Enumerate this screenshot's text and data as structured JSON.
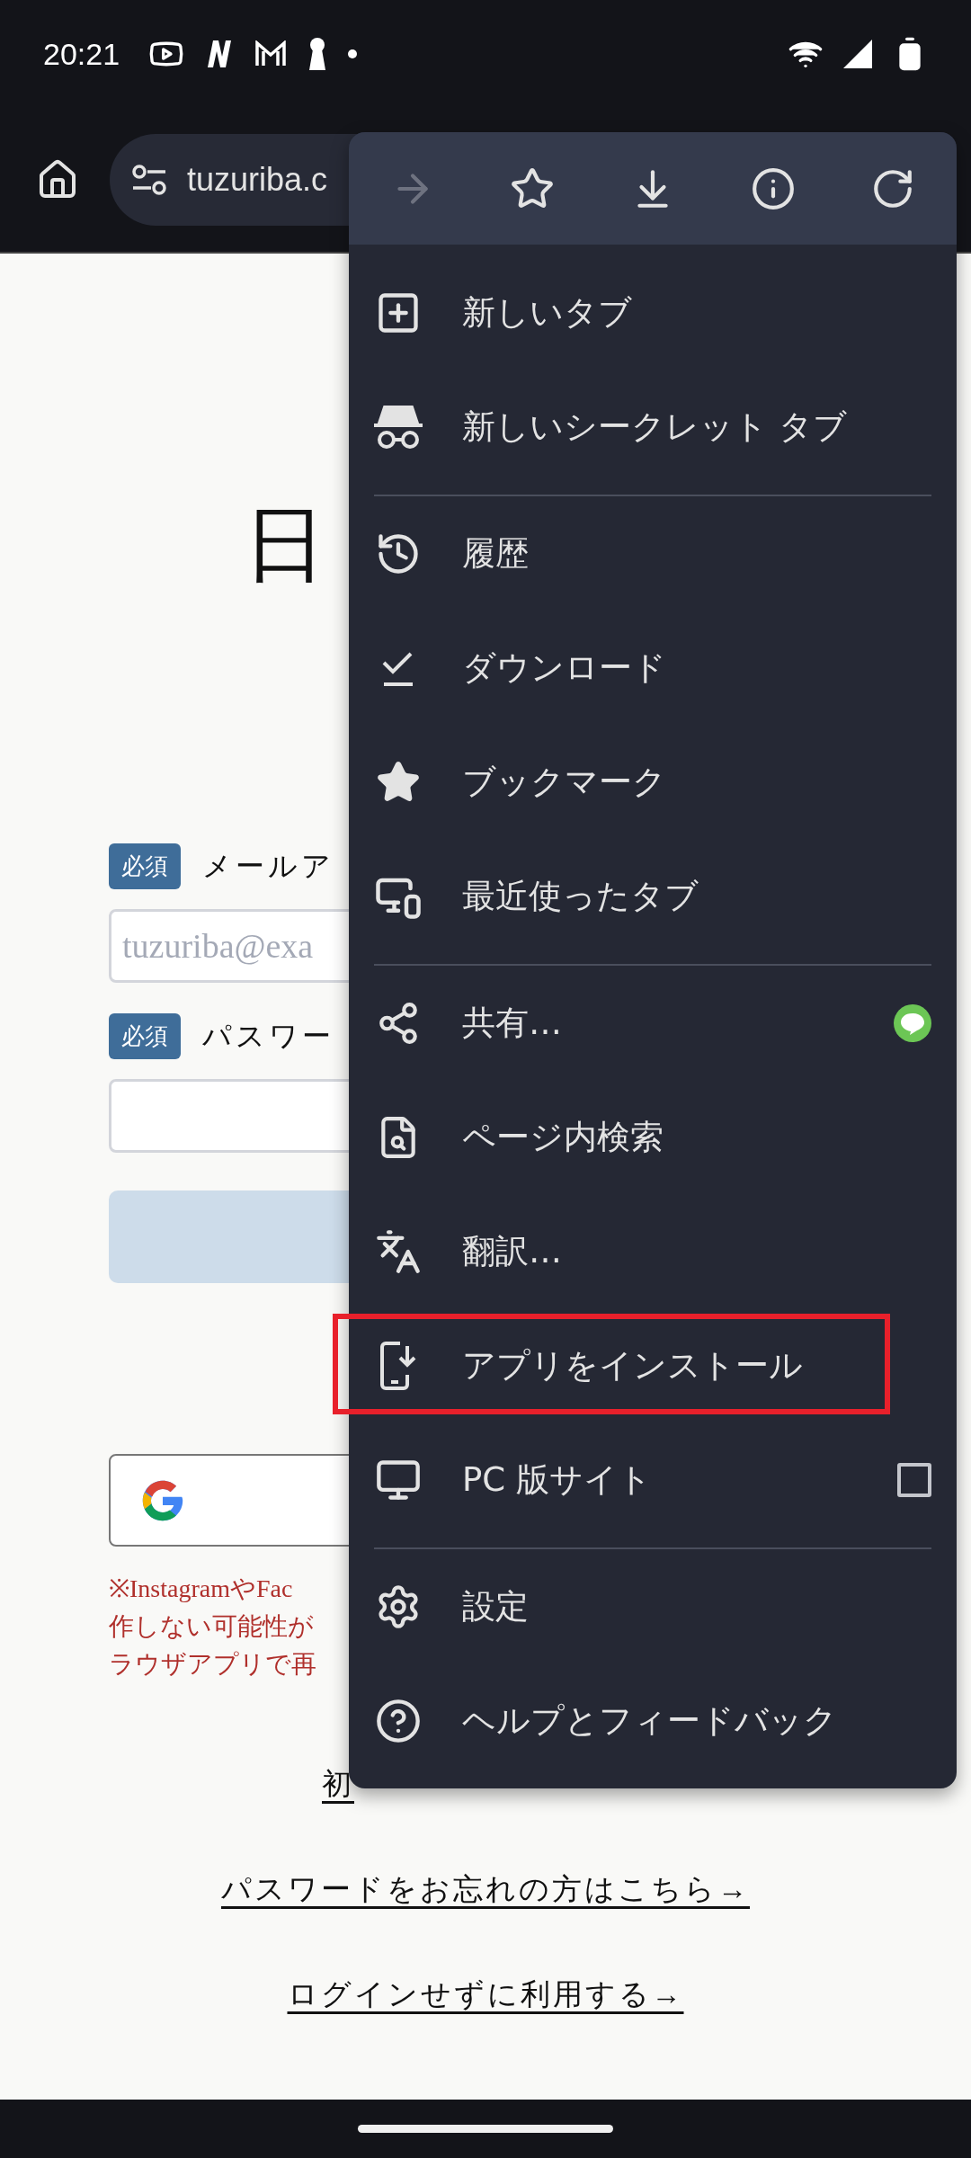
{
  "status_bar": {
    "time": "20:21"
  },
  "toolbar": {
    "url": "tuzuriba.c"
  },
  "page": {
    "title": "日",
    "fields": [
      {
        "badge": "必須",
        "label": "メールア",
        "placeholder": "tuzuriba@exa"
      },
      {
        "badge": "必須",
        "label": "パスワー"
      }
    ],
    "notice_lines": [
      "※InstagramやFac",
      "作しない可能性が",
      "ラウザアプリで再"
    ],
    "links": [
      "初",
      "パスワードをお忘れの方はこちら→",
      "ログインせずに利用する→"
    ]
  },
  "menu": {
    "top_actions": [
      {
        "disabled": true
      },
      {
        "disabled": false
      },
      {
        "disabled": false
      },
      {
        "disabled": false
      },
      {
        "disabled": false
      }
    ],
    "groups": [
      [
        {
          "kind": "plain",
          "label": "新しいタブ",
          "highlighted": false
        },
        {
          "kind": "plain",
          "label": "新しいシークレット タブ",
          "highlighted": false
        }
      ],
      [
        {
          "kind": "plain",
          "label": "履歴",
          "highlighted": false
        },
        {
          "kind": "plain",
          "label": "ダウンロード",
          "highlighted": false
        },
        {
          "kind": "plain",
          "label": "ブックマーク",
          "highlighted": false
        },
        {
          "kind": "plain",
          "label": "最近使ったタブ",
          "highlighted": false
        }
      ],
      [
        {
          "kind": "share",
          "label": "共有…",
          "highlighted": false
        },
        {
          "kind": "plain",
          "label": "ページ内検索",
          "highlighted": false
        },
        {
          "kind": "plain",
          "label": "翻訳…",
          "highlighted": false
        },
        {
          "kind": "plain",
          "label": "アプリをインストール",
          "highlighted": true
        },
        {
          "kind": "checkbox",
          "label": "PC 版サイト",
          "checked": false,
          "highlighted": false
        }
      ],
      [
        {
          "kind": "plain",
          "label": "設定",
          "highlighted": false
        },
        {
          "kind": "plain",
          "label": "ヘルプとフィードバック",
          "highlighted": false
        }
      ]
    ]
  }
}
